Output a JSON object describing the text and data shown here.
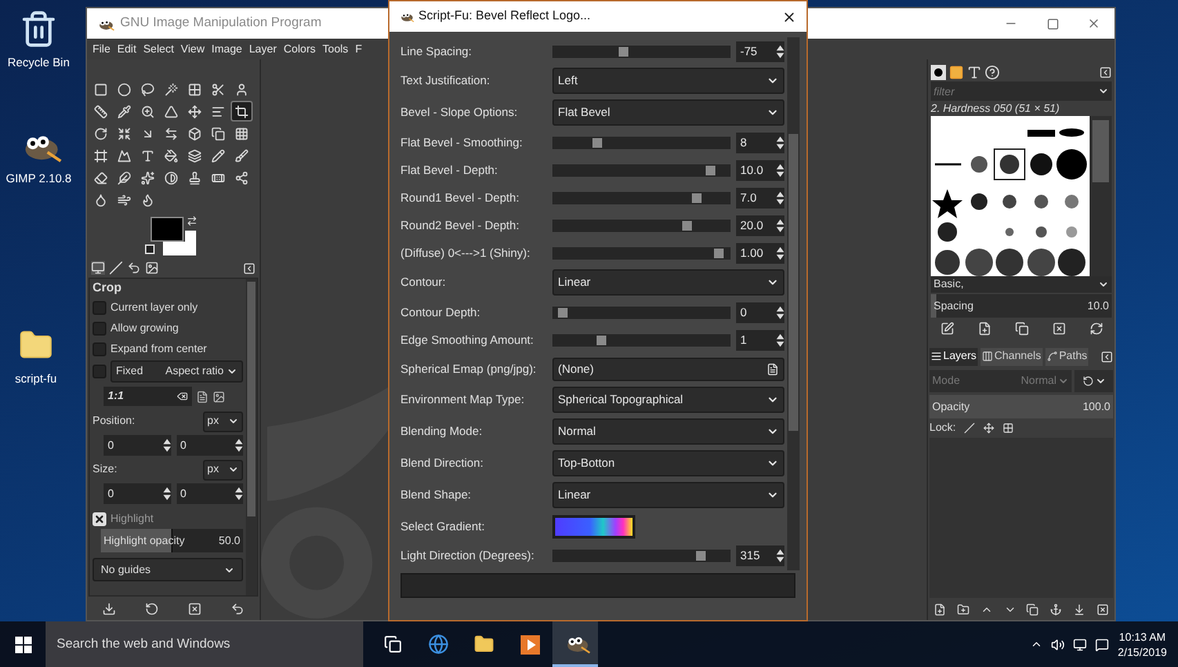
{
  "desktop": {
    "icons": [
      {
        "label": "Recycle Bin",
        "kind": "recycle"
      },
      {
        "label": "GIMP 2.10.8",
        "kind": "app"
      },
      {
        "label": "script-fu",
        "kind": "folder"
      }
    ]
  },
  "gimp_window": {
    "title": "GNU Image Manipulation Program",
    "menu": [
      "File",
      "Edit",
      "Select",
      "View",
      "Image",
      "Layer",
      "Colors",
      "Tools",
      "F"
    ],
    "toolbox": {
      "tools": [
        {
          "selected": false
        },
        {
          "selected": false
        },
        {
          "selected": false
        },
        {
          "selected": false
        },
        {
          "selected": false
        },
        {
          "selected": false
        },
        {
          "selected": false
        },
        {
          "selected": false
        },
        {
          "selected": false
        },
        {
          "selected": false
        },
        {
          "selected": false
        },
        {
          "selected": false
        },
        {
          "selected": false
        },
        {
          "selected": true
        },
        {
          "selected": false
        },
        {
          "selected": false
        },
        {
          "selected": false
        },
        {
          "selected": false
        },
        {
          "selected": false
        },
        {
          "selected": false
        },
        {
          "selected": false
        },
        {
          "selected": false
        },
        {
          "selected": false
        },
        {
          "selected": false
        },
        {
          "selected": false
        },
        {
          "selected": false
        },
        {
          "selected": false
        },
        {
          "selected": false
        },
        {
          "selected": false
        },
        {
          "selected": false
        },
        {
          "selected": false
        },
        {
          "selected": false
        },
        {
          "selected": false
        },
        {
          "selected": false
        },
        {
          "selected": false
        },
        {
          "selected": false
        },
        {
          "selected": false
        },
        {
          "selected": false
        }
      ]
    },
    "tool_options": {
      "title": "Crop",
      "options": [
        {
          "label": "Current layer only",
          "checked": false
        },
        {
          "label": "Allow growing",
          "checked": false
        },
        {
          "label": "Expand from center",
          "checked": false
        }
      ],
      "fixed": {
        "checked": false,
        "label": "Fixed",
        "value": "Aspect ratio"
      },
      "ratio_field": "1:1",
      "position": {
        "label": "Position:",
        "unit": "px",
        "values": [
          "0",
          "0"
        ]
      },
      "size": {
        "label": "Size:",
        "unit": "px",
        "values": [
          "0",
          "0"
        ]
      },
      "highlight": {
        "label": "Highlight",
        "checked": true
      },
      "highlight_opacity": {
        "label": "Highlight opacity",
        "value": "50.0",
        "level": 0.5
      },
      "guides": "No guides"
    },
    "dock": {
      "filter_placeholder": "filter",
      "brush_name": "2. Hardness 050 (51 × 51)",
      "preset": "Basic,",
      "spacing": {
        "label": "Spacing",
        "value": "10.0",
        "level": 0.03
      },
      "layer_tabs": [
        {
          "label": "Layers",
          "selected": true
        },
        {
          "label": "Channels",
          "selected": false
        },
        {
          "label": "Paths",
          "selected": false
        }
      ],
      "mode": {
        "label": "Mode",
        "value": "Normal",
        "disabled": true
      },
      "opacity": {
        "label": "Opacity",
        "value": "100.0",
        "level": 1
      },
      "lock_label": "Lock:"
    }
  },
  "dialog": {
    "title": "Script-Fu: Bevel Reflect Logo...",
    "rows": [
      {
        "kind": "slider",
        "label": "Line Spacing:",
        "value": "-75",
        "level": 0.39
      },
      {
        "kind": "dropdown",
        "label": "Text Justification:",
        "value": "Left"
      },
      {
        "kind": "dropdown",
        "label": "Bevel - Slope Options:",
        "value": "Flat Bevel"
      },
      {
        "kind": "slider",
        "label": "Flat Bevel - Smoothing:",
        "value": "8",
        "level": 0.24
      },
      {
        "kind": "slider",
        "label": "Flat Bevel - Depth:",
        "value": "10.0",
        "level": 0.91
      },
      {
        "kind": "slider",
        "label": "Round1 Bevel - Depth:",
        "value": "7.0",
        "level": 0.83
      },
      {
        "kind": "slider",
        "label": "Round2 Bevel - Depth:",
        "value": "20.0",
        "level": 0.77
      },
      {
        "kind": "slider",
        "label": "(Diffuse) 0<--->1 (Shiny):",
        "value": "1.00",
        "level": 0.96
      },
      {
        "kind": "dropdown",
        "label": "Contour:",
        "value": "Linear"
      },
      {
        "kind": "slider",
        "label": "Contour Depth:",
        "value": "0",
        "level": 0.03
      },
      {
        "kind": "slider",
        "label": "Edge Smoothing Amount:",
        "value": "1",
        "level": 0.26
      },
      {
        "kind": "file",
        "label": "Spherical Emap (png/jpg):",
        "value": "(None)"
      },
      {
        "kind": "dropdown",
        "label": "Environment Map Type:",
        "value": "Spherical Topographical"
      },
      {
        "kind": "dropdown",
        "label": "Blending Mode:",
        "value": "Normal"
      },
      {
        "kind": "dropdown",
        "label": "Blend Direction:",
        "value": "Top-Botton"
      },
      {
        "kind": "dropdown",
        "label": "Blend Shape:",
        "value": "Linear"
      },
      {
        "kind": "gradient",
        "label": "Select Gradient:"
      },
      {
        "kind": "slider",
        "label": "Light Direction (Degrees):",
        "value": "315",
        "level": 0.85
      }
    ],
    "progress": {
      "level": 0
    }
  },
  "taskbar": {
    "search_placeholder": "Search the web and Windows",
    "apps": [
      {
        "kind": "taskview",
        "active": false
      },
      {
        "kind": "edge",
        "active": false
      },
      {
        "kind": "explorer",
        "active": false
      },
      {
        "kind": "media",
        "active": false
      },
      {
        "kind": "gimp",
        "active": true
      }
    ],
    "time": "10:13 AM",
    "date": "2/15/2019"
  }
}
